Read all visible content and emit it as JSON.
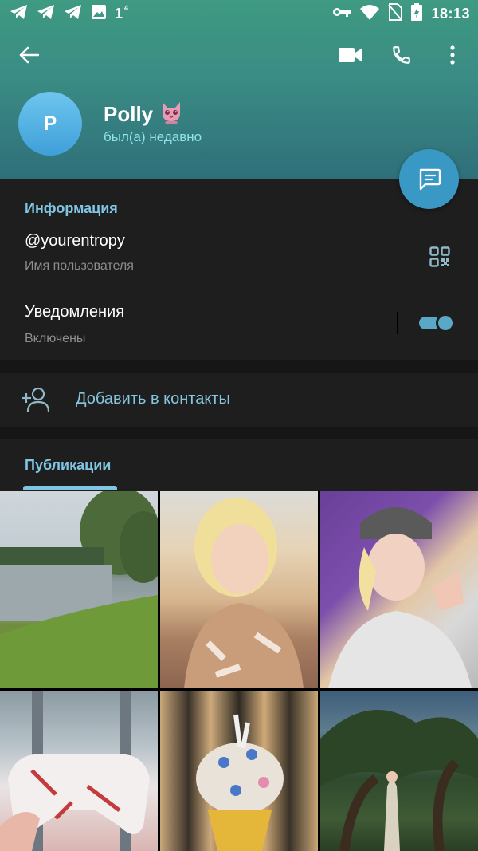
{
  "status_bar": {
    "time": "18:13",
    "left_icons": [
      "telegram-icon",
      "telegram-icon",
      "telegram-icon",
      "image-icon"
    ],
    "signal_digit": "1",
    "signal_sup": "4",
    "right_icons": [
      "key-icon",
      "wifi-icon",
      "no-sim-icon",
      "battery-charging-icon"
    ]
  },
  "toolbar": {
    "back_icon": "arrow-back-icon",
    "video_icon": "video-camera-icon",
    "call_icon": "phone-icon",
    "more_icon": "more-vert-icon"
  },
  "profile": {
    "avatar_letter": "P",
    "name": "Polly",
    "name_emoji": "🐱",
    "last_seen": "был(а) недавно"
  },
  "fab": {
    "icon": "message-icon"
  },
  "info": {
    "section_title": "Информация",
    "username": "@yourentropy",
    "username_caption": "Имя пользователя",
    "qr_icon": "qr-code-icon",
    "notifications_label": "Уведомления",
    "notifications_status": "Включены",
    "notifications_enabled": true
  },
  "add_contact": {
    "icon": "add-person-icon",
    "label": "Добавить в контакты"
  },
  "publications": {
    "section_title": "Публикации",
    "photos": [
      {
        "subject": "lake-landscape"
      },
      {
        "subject": "portrait-selfie"
      },
      {
        "subject": "purple-wall-portrait"
      },
      {
        "subject": "gamepad"
      },
      {
        "subject": "ice-cream"
      },
      {
        "subject": "tree-photo"
      }
    ]
  },
  "colors": {
    "header_top": "#3e9a82",
    "header_bottom": "#2f6f7a",
    "accent": "#80c6e3",
    "fab": "#3a98c4",
    "surface": "#1e1e1e",
    "background": "#161616"
  }
}
